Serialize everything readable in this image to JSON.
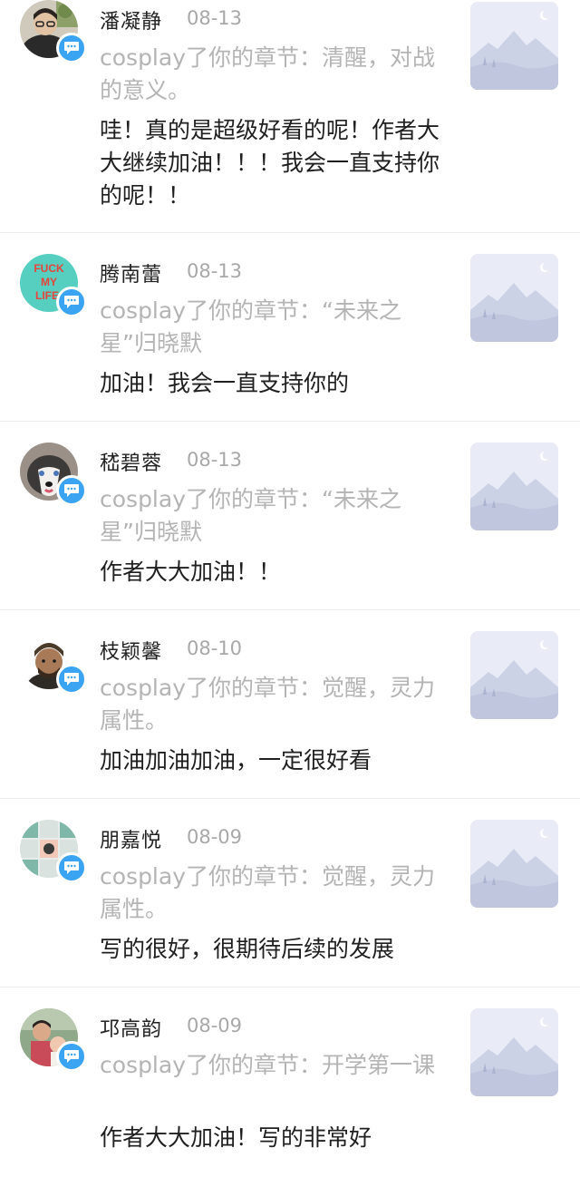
{
  "notifications": [
    {
      "user": "潘凝静",
      "date": "08-13",
      "source": "cosplay了你的章节：清醒，对战的意义。",
      "comment": "哇！真的是超级好看的呢！作者大大继续加油！！！我会一直支持你的呢！！",
      "avatar": "avatar-man-glasses-plant"
    },
    {
      "user": "腾南蕾",
      "date": "08-13",
      "source": "cosplay了你的章节：“未来之星”归晓默",
      "comment": "加油！我会一直支持你的",
      "avatar": "avatar-text-fuck-my-life",
      "avatar_text": [
        "FUCK",
        "MY",
        "LIFE"
      ]
    },
    {
      "user": "嵇碧蓉",
      "date": "08-13",
      "source": "cosplay了你的章节：“未来之星”归晓默",
      "comment": "作者大大加油！！",
      "avatar": "avatar-husky-dog"
    },
    {
      "user": "枝颖馨",
      "date": "08-10",
      "source": "cosplay了你的章节：觉醒，灵力属性。",
      "comment": "加油加油加油，一定很好看",
      "avatar": "avatar-man-beanie"
    },
    {
      "user": "朋嘉悦",
      "date": "08-09",
      "source": "cosplay了你的章节：觉醒，灵力属性。",
      "comment": "写的很好，很期待后续的发展",
      "avatar": "avatar-cartoon-pattern"
    },
    {
      "user": "邛高韵",
      "date": "08-09",
      "source": "cosplay了你的章节：开学第一课",
      "comment": "作者大大加油！写的非常好",
      "avatar": "avatar-woman-child"
    }
  ],
  "colors": {
    "badge": "#3aa3f2",
    "source_text": "#b4b4b4",
    "date_text": "#a8a8a8",
    "divider": "#ececec",
    "thumb_bg": "#e9ecf6",
    "thumb_mountain": "#ccd2e6"
  },
  "icons": {
    "badge": "chat-bubble-icon",
    "thumbnail": "mountain-placeholder-icon"
  }
}
